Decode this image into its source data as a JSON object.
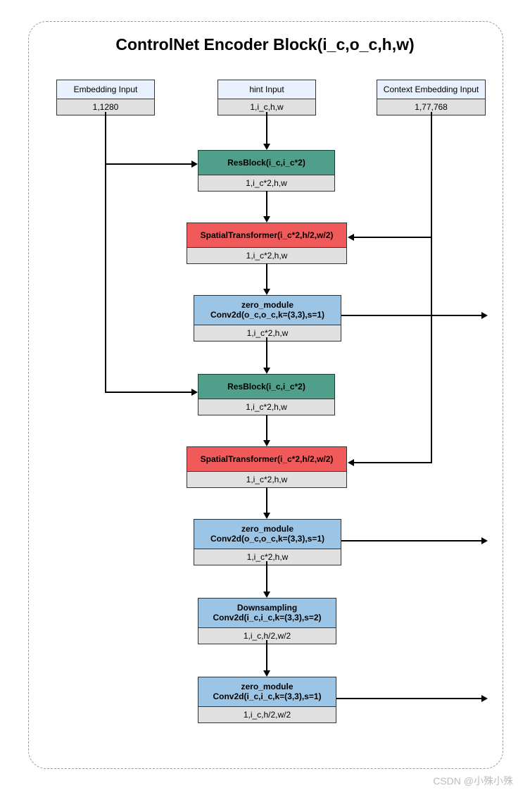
{
  "title": "ControlNet Encoder Block(i_c,o_c,h,w)",
  "inputs": {
    "embed": {
      "label": "Embedding Input",
      "shape": "1,1280"
    },
    "hint": {
      "label": "hint Input",
      "shape": "1,i_c,h,w"
    },
    "context": {
      "label": "Context Embedding Input",
      "shape": "1,77,768"
    }
  },
  "blocks": {
    "res1": {
      "label": "ResBlock(i_c,i_c*2)",
      "shape": "1,i_c*2,h,w"
    },
    "spat1": {
      "label": "SpatialTransformer(i_c*2,h/2,w/2)",
      "shape": "1,i_c*2,h,w"
    },
    "zero1": {
      "label1": "zero_module",
      "label2": "Conv2d(o_c,o_c,k=(3,3),s=1)",
      "shape": "1,i_c*2,h,w"
    },
    "res2": {
      "label": "ResBlock(i_c,i_c*2)",
      "shape": "1,i_c*2,h,w"
    },
    "spat2": {
      "label": "SpatialTransformer(i_c*2,h/2,w/2)",
      "shape": "1,i_c*2,h,w"
    },
    "zero2": {
      "label1": "zero_module",
      "label2": "Conv2d(o_c,o_c,k=(3,3),s=1)",
      "shape": "1,i_c*2,h,w"
    },
    "down": {
      "label1": "Downsampling",
      "label2": "Conv2d(i_c,i_c,k=(3,3),s=2)",
      "shape": "1,i_c,h/2,w/2"
    },
    "zero3": {
      "label1": "zero_module",
      "label2": "Conv2d(i_c,i_c,k=(3,3),s=1)",
      "shape": "1,i_c,h/2,w/2"
    }
  },
  "watermark": "CSDN @小殊小殊"
}
